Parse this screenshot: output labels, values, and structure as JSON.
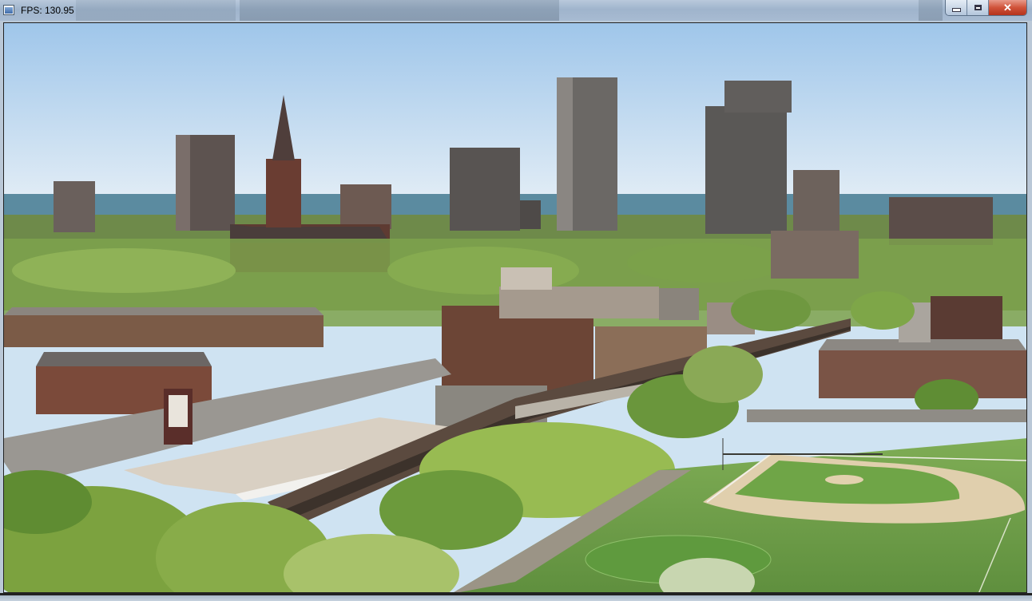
{
  "window": {
    "fps_text": "FPS: 130.95",
    "controls": {
      "minimize_icon": "minimize-icon",
      "maximize_icon": "maximize-icon",
      "close_icon": "close-icon",
      "close_glyph": "✕"
    }
  },
  "scene": {
    "description_icon": "video-frame",
    "colors": {
      "sky_top": "#9ec4e8",
      "sky_bottom": "#e3eef6",
      "lake": "#5a8aa0",
      "foliage": "#6f9a3e",
      "field": "#7aa552",
      "infield": "#e0cfae",
      "brick": "#6b3b2d",
      "tower": "#5a5552"
    }
  }
}
